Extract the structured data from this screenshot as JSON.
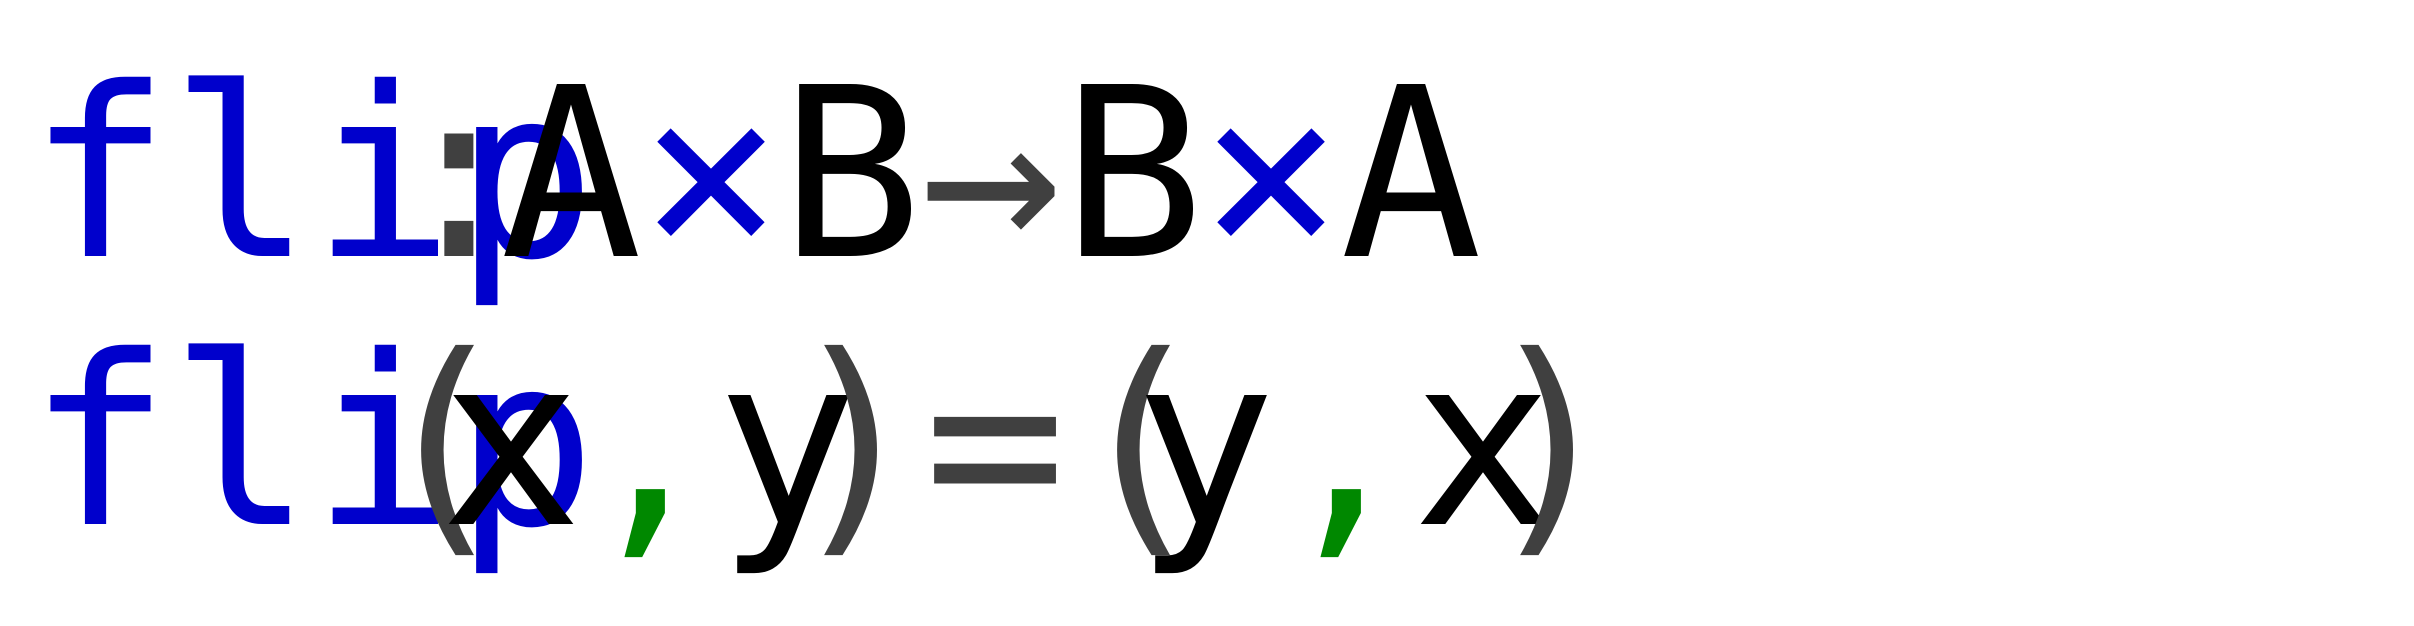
{
  "colors": {
    "function_name": "#0000cc",
    "type_variable": "#000000",
    "symbol": "#404040",
    "comma": "#008800",
    "product_operator": "#0000cc",
    "background": "#ffffff"
  },
  "signature": {
    "name": "flip",
    "colon": ":",
    "type_a": "A",
    "times_1": "×",
    "type_b": "B",
    "arrow": "→",
    "result_b": "B",
    "times_2": "×",
    "result_a": "A"
  },
  "definition": {
    "name": "flip",
    "lparen_1": "(",
    "var_x": "x",
    "comma_1": ",",
    "var_y": "y",
    "rparen_1": ")",
    "equals": "=",
    "lparen_2": "(",
    "result_y": "y",
    "comma_2": ",",
    "result_x": "x",
    "rparen_2": ")"
  }
}
